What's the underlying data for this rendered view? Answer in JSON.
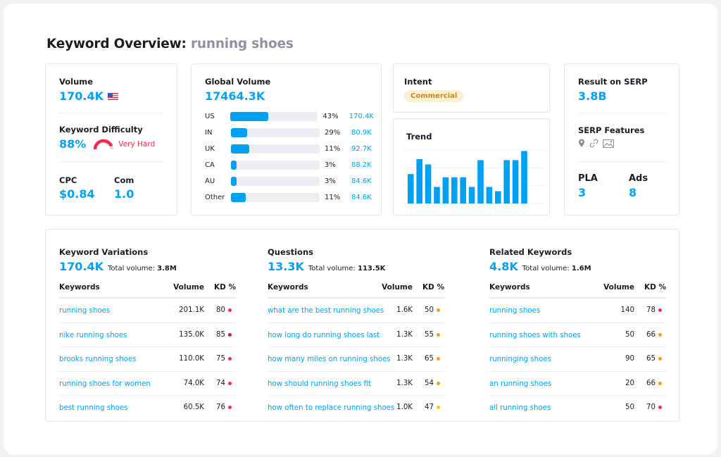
{
  "header": {
    "title_prefix": "Keyword Overview:",
    "keyword": "running shoes"
  },
  "overview": {
    "volume_label": "Volume",
    "volume_value": "170.4K",
    "volume_flag": "us-flag-icon",
    "kd_label": "Keyword Difficulty",
    "kd_value": "88%",
    "kd_percent": 88,
    "kd_status": "Very Hard",
    "kd_color": "#ee2d4d",
    "cpc_label": "CPC",
    "cpc_value": "$0.84",
    "com_label": "Com",
    "com_value": "1.0"
  },
  "global_volume": {
    "label": "Global Volume",
    "value": "17464.3K",
    "rows": [
      {
        "country": "US",
        "percent": "43%",
        "share": 0.43,
        "value": "170.4K"
      },
      {
        "country": "IN",
        "percent": "29%",
        "share": 0.18,
        "value": "80.9K"
      },
      {
        "country": "UK",
        "percent": "11%",
        "share": 0.21,
        "value": "92.7K"
      },
      {
        "country": "CA",
        "percent": "3%",
        "share": 0.06,
        "value": "88.2K"
      },
      {
        "country": "AU",
        "percent": "3%",
        "share": 0.06,
        "value": "84.6K"
      },
      {
        "country": "Other",
        "percent": "11%",
        "share": 0.17,
        "value": "84.6K"
      }
    ]
  },
  "intent": {
    "label": "Intent",
    "value": "Commercial"
  },
  "trend": {
    "label": "Trend",
    "values": [
      0.55,
      0.83,
      0.73,
      0.31,
      0.49,
      0.49,
      0.49,
      0.31,
      0.81,
      0.31,
      0.23,
      0.81,
      0.81,
      0.98
    ]
  },
  "serp": {
    "result_label": "Result on SERP",
    "result_value": "3.8B",
    "features_label": "SERP Features",
    "features": [
      "location-pin-icon",
      "link-icon",
      "image-icon"
    ],
    "pla_label": "PLA",
    "pla_value": "3",
    "ads_label": "Ads",
    "ads_value": "8"
  },
  "sections": [
    {
      "title": "Keyword Variations",
      "count": "170.4K",
      "total_label": "Total volume:",
      "total_value": "3.8M",
      "columns": [
        "Keywords",
        "Volume",
        "KD %"
      ],
      "rows": [
        {
          "keyword": "running shoes",
          "volume": "201.1K",
          "kd": "80",
          "kd_color": "#ee2d4d"
        },
        {
          "keyword": "nike running shoes",
          "volume": "135.0K",
          "kd": "85",
          "kd_color": "#c21c3c"
        },
        {
          "keyword": "brooks running shoes",
          "volume": "110.0K",
          "kd": "75",
          "kd_color": "#ee2d4d"
        },
        {
          "keyword": "running shoes for women",
          "volume": "74.0K",
          "kd": "74",
          "kd_color": "#ee2d4d"
        },
        {
          "keyword": "best running shoes",
          "volume": "60.5K",
          "kd": "76",
          "kd_color": "#ee2d4d"
        }
      ]
    },
    {
      "title": "Questions",
      "count": "13.3K",
      "total_label": "Total volume:",
      "total_value": "113.5K",
      "columns": [
        "Keywords",
        "Volume",
        "KD %"
      ],
      "rows": [
        {
          "keyword": "what are the best running shoes",
          "volume": "1.6K",
          "kd": "50",
          "kd_color": "#ff9a1f"
        },
        {
          "keyword": "how long do running shoes last",
          "volume": "1.3K",
          "kd": "55",
          "kd_color": "#ff9a1f"
        },
        {
          "keyword": "how many miles on running shoes",
          "volume": "1.3K",
          "kd": "65",
          "kd_color": "#ff9a1f"
        },
        {
          "keyword": "how should running shoes fit",
          "volume": "1.3K",
          "kd": "54",
          "kd_color": "#ff9a1f"
        },
        {
          "keyword": "how often to replace running shoes",
          "volume": "1.0K",
          "kd": "47",
          "kd_color": "#ffc21a"
        }
      ]
    },
    {
      "title": "Related Keywords",
      "count": "4.8K",
      "total_label": "Total volume:",
      "total_value": "1.6M",
      "columns": [
        "Keywords",
        "Volume",
        "KD %"
      ],
      "rows": [
        {
          "keyword": "running shoes",
          "volume": "140",
          "kd": "78",
          "kd_color": "#ee2d4d"
        },
        {
          "keyword": "running shoes with shoes",
          "volume": "50",
          "kd": "66",
          "kd_color": "#ff9a1f"
        },
        {
          "keyword": "runninging shoes",
          "volume": "90",
          "kd": "65",
          "kd_color": "#ff9a1f"
        },
        {
          "keyword": "an running shoes",
          "volume": "20",
          "kd": "66",
          "kd_color": "#ff9a1f"
        },
        {
          "keyword": "all running shoes",
          "volume": "50",
          "kd": "70",
          "kd_color": "#ee2d4d"
        }
      ]
    }
  ]
}
